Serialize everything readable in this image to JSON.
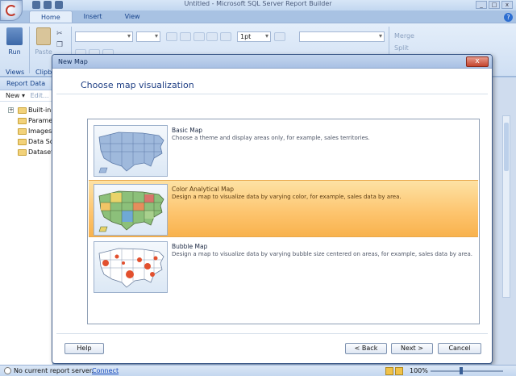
{
  "app": {
    "title": "Untitled - Microsoft SQL Server Report Builder",
    "tabs": [
      "Home",
      "Insert",
      "View"
    ],
    "active_tab": "Home"
  },
  "ribbon": {
    "run_label": "Run",
    "paste_label": "Paste",
    "group_views": "Views",
    "group_clipboard": "Clipb",
    "font_size_value": "1pt",
    "merge_label": "Merge",
    "split_label": "Split"
  },
  "report_data": {
    "title": "Report Data",
    "new_label": "New ▾",
    "edit_label": "Edit...",
    "items": [
      {
        "label": "Built-in",
        "expandable": true
      },
      {
        "label": "Paramet",
        "expandable": false
      },
      {
        "label": "Images",
        "expandable": false
      },
      {
        "label": "Data Sou",
        "expandable": false
      },
      {
        "label": "Datasets",
        "expandable": false
      }
    ]
  },
  "dialog": {
    "title": "New Map",
    "close_symbol": "x",
    "heading": "Choose map visualization",
    "options": [
      {
        "name": "Basic Map",
        "description": "Choose a theme and display areas only, for example, sales territories.",
        "selected": false
      },
      {
        "name": "Color Analytical Map",
        "description": "Design a map to visualize data by varying color, for example, sales data by area.",
        "selected": true
      },
      {
        "name": "Bubble Map",
        "description": "Design a map to visualize data by varying bubble size centered on areas, for example, sales data by area.",
        "selected": false
      }
    ],
    "help_label": "Help",
    "back_label": "< Back",
    "next_label": "Next >",
    "cancel_label": "Cancel"
  },
  "status": {
    "server_text": "No current report server.",
    "connect_label": "Connect",
    "zoom": "100%"
  },
  "colors": {
    "selected_option": "#fdc36c",
    "heading_blue": "#1f3f84",
    "ribbon_bg": "#e4eefa"
  }
}
